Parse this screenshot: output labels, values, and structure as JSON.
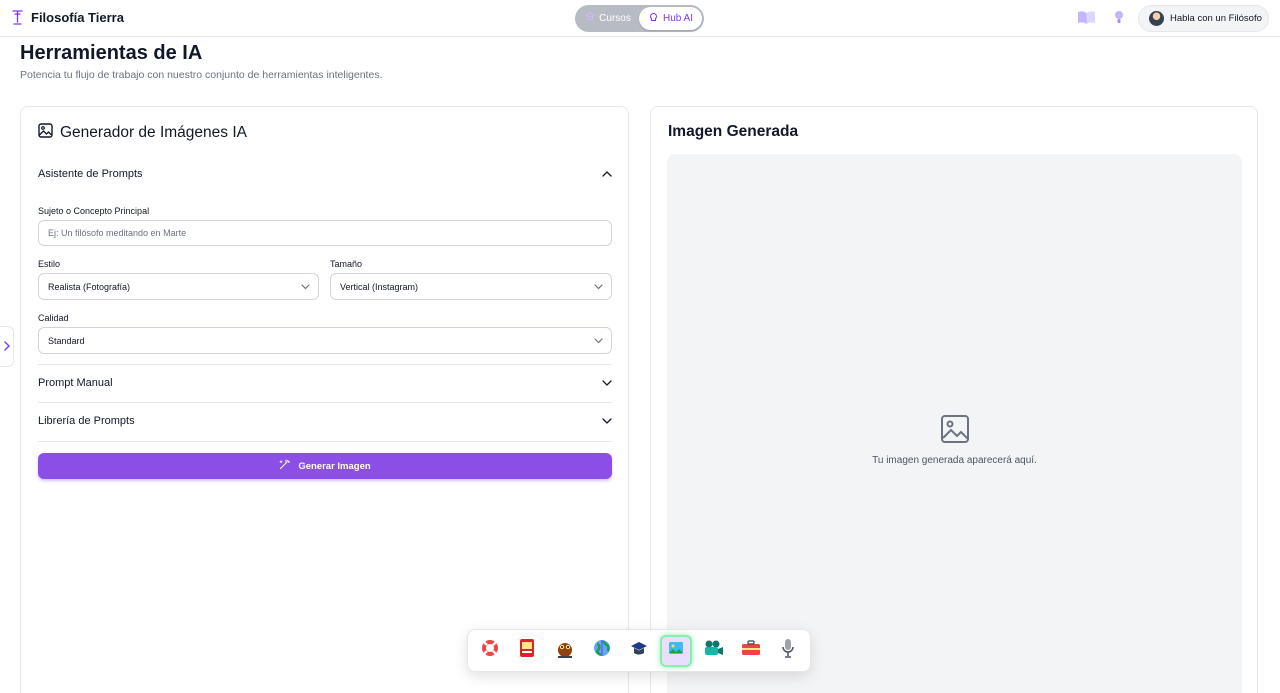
{
  "header": {
    "brand_name": "Filosofía Tierra",
    "toggle": {
      "off_label": "Cursos",
      "on_label": "Hub AI"
    },
    "philosopher_button": "Habla con un Filósofo"
  },
  "page": {
    "title": "Herramientas de IA",
    "subtitle": "Potencia tu flujo de trabajo con nuestro conjunto de herramientas inteligentes."
  },
  "generator": {
    "title": "Generador de Imágenes IA",
    "assistant": {
      "heading": "Asistente de Prompts",
      "subject_label": "Sujeto o Concepto Principal",
      "subject_placeholder": "Ej: Un filósofo meditando en Marte",
      "style_label": "Estilo",
      "style_value": "Realista (Fotografía)",
      "size_label": "Tamaño",
      "size_value": "Vertical (Instagram)",
      "quality_label": "Calidad",
      "quality_value": "Standard"
    },
    "manual_heading": "Prompt Manual",
    "library_heading": "Librería de Prompts",
    "generate_button": "Generar Imagen"
  },
  "output": {
    "title": "Imagen Generada",
    "placeholder": "Tu imagen generada aparecerá aquí."
  },
  "colors": {
    "accent": "#8b4fe8",
    "accent_text": "#7c3aed",
    "dock_active_ring": "#86efac"
  },
  "dock": {
    "active_index": 5,
    "items": [
      "lifebuoy-icon",
      "book-app-icon",
      "owl-icon",
      "globe-icon",
      "graduation-cap-icon",
      "image-generator-icon",
      "video-camera-icon",
      "toolbox-icon",
      "microphone-icon"
    ]
  }
}
